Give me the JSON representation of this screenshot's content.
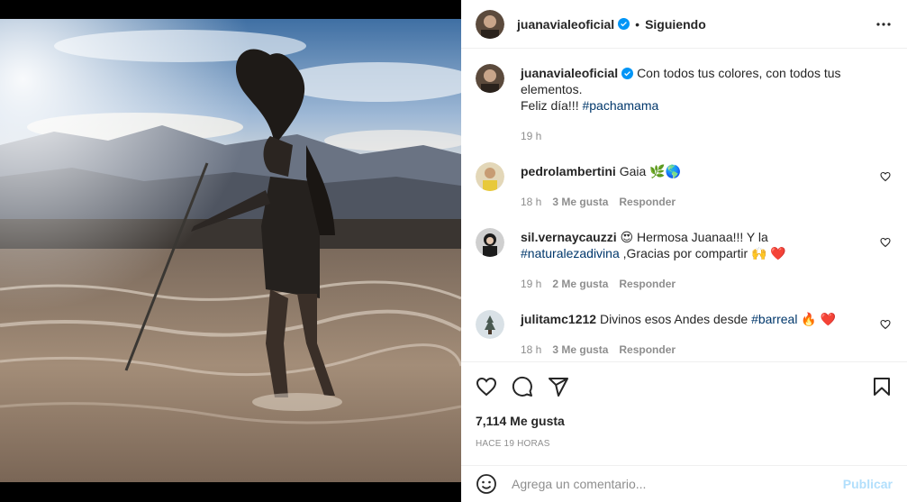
{
  "post": {
    "author": "juanavialeoficial",
    "follow_status": "Siguiendo",
    "caption_line1": "Con todos tus colores, con todos tus elementos.",
    "caption_line2": "Feliz día!!! ",
    "caption_hashtag": "#pachamama",
    "caption_time": "19 h"
  },
  "comments": [
    {
      "user": "pedrolambertini",
      "text": "Gaia ",
      "emoji": "🌿🌎",
      "time": "18 h",
      "likes": "3 Me gusta",
      "reply": "Responder"
    },
    {
      "user": "sil.vernaycauzzi",
      "pre": "😍 Hermosa Juanaa!!! Y la ",
      "hashtag": "#naturalezadivina",
      "post": " ,Gracias por compartir 🙌 ❤️",
      "time": "19 h",
      "likes": "2 Me gusta",
      "reply": "Responder"
    },
    {
      "user": "julitamc1212",
      "pre": "Divinos esos Andes desde ",
      "hashtag": "#barreal",
      "post": " 🔥 ❤️",
      "time": "18 h",
      "likes": "3 Me gusta",
      "reply": "Responder"
    }
  ],
  "stats": {
    "likes": "7,114 Me gusta",
    "posted": "HACE 19 HORAS"
  },
  "composer": {
    "placeholder": "Agrega un comentario...",
    "publish": "Publicar"
  },
  "icons": [
    "more-icon",
    "verified-icon",
    "heart-icon",
    "comment-icon",
    "share-icon",
    "save-icon",
    "emoji-icon"
  ],
  "colors": {
    "link": "#00376b",
    "muted": "#8e8e8e",
    "publish": "#b2dffc",
    "verified": "#0095f6"
  }
}
